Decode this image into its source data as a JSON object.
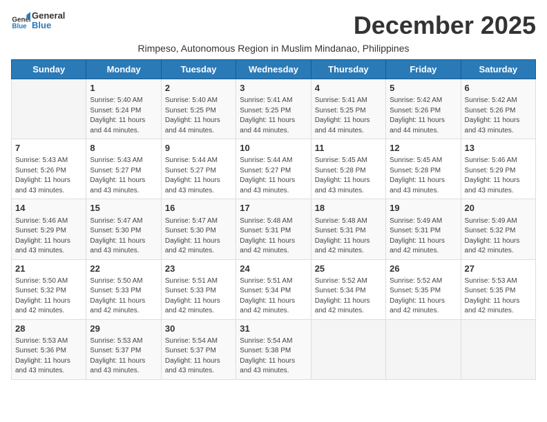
{
  "logo": {
    "general": "General",
    "blue": "Blue"
  },
  "title": "December 2025",
  "subtitle": "Rimpeso, Autonomous Region in Muslim Mindanao, Philippines",
  "days_of_week": [
    "Sunday",
    "Monday",
    "Tuesday",
    "Wednesday",
    "Thursday",
    "Friday",
    "Saturday"
  ],
  "weeks": [
    [
      {
        "day": "",
        "sunrise": "",
        "sunset": "",
        "daylight": ""
      },
      {
        "day": "1",
        "sunrise": "Sunrise: 5:40 AM",
        "sunset": "Sunset: 5:24 PM",
        "daylight": "Daylight: 11 hours and 44 minutes."
      },
      {
        "day": "2",
        "sunrise": "Sunrise: 5:40 AM",
        "sunset": "Sunset: 5:25 PM",
        "daylight": "Daylight: 11 hours and 44 minutes."
      },
      {
        "day": "3",
        "sunrise": "Sunrise: 5:41 AM",
        "sunset": "Sunset: 5:25 PM",
        "daylight": "Daylight: 11 hours and 44 minutes."
      },
      {
        "day": "4",
        "sunrise": "Sunrise: 5:41 AM",
        "sunset": "Sunset: 5:25 PM",
        "daylight": "Daylight: 11 hours and 44 minutes."
      },
      {
        "day": "5",
        "sunrise": "Sunrise: 5:42 AM",
        "sunset": "Sunset: 5:26 PM",
        "daylight": "Daylight: 11 hours and 44 minutes."
      },
      {
        "day": "6",
        "sunrise": "Sunrise: 5:42 AM",
        "sunset": "Sunset: 5:26 PM",
        "daylight": "Daylight: 11 hours and 43 minutes."
      }
    ],
    [
      {
        "day": "7",
        "sunrise": "Sunrise: 5:43 AM",
        "sunset": "Sunset: 5:26 PM",
        "daylight": "Daylight: 11 hours and 43 minutes."
      },
      {
        "day": "8",
        "sunrise": "Sunrise: 5:43 AM",
        "sunset": "Sunset: 5:27 PM",
        "daylight": "Daylight: 11 hours and 43 minutes."
      },
      {
        "day": "9",
        "sunrise": "Sunrise: 5:44 AM",
        "sunset": "Sunset: 5:27 PM",
        "daylight": "Daylight: 11 hours and 43 minutes."
      },
      {
        "day": "10",
        "sunrise": "Sunrise: 5:44 AM",
        "sunset": "Sunset: 5:27 PM",
        "daylight": "Daylight: 11 hours and 43 minutes."
      },
      {
        "day": "11",
        "sunrise": "Sunrise: 5:45 AM",
        "sunset": "Sunset: 5:28 PM",
        "daylight": "Daylight: 11 hours and 43 minutes."
      },
      {
        "day": "12",
        "sunrise": "Sunrise: 5:45 AM",
        "sunset": "Sunset: 5:28 PM",
        "daylight": "Daylight: 11 hours and 43 minutes."
      },
      {
        "day": "13",
        "sunrise": "Sunrise: 5:46 AM",
        "sunset": "Sunset: 5:29 PM",
        "daylight": "Daylight: 11 hours and 43 minutes."
      }
    ],
    [
      {
        "day": "14",
        "sunrise": "Sunrise: 5:46 AM",
        "sunset": "Sunset: 5:29 PM",
        "daylight": "Daylight: 11 hours and 43 minutes."
      },
      {
        "day": "15",
        "sunrise": "Sunrise: 5:47 AM",
        "sunset": "Sunset: 5:30 PM",
        "daylight": "Daylight: 11 hours and 43 minutes."
      },
      {
        "day": "16",
        "sunrise": "Sunrise: 5:47 AM",
        "sunset": "Sunset: 5:30 PM",
        "daylight": "Daylight: 11 hours and 42 minutes."
      },
      {
        "day": "17",
        "sunrise": "Sunrise: 5:48 AM",
        "sunset": "Sunset: 5:31 PM",
        "daylight": "Daylight: 11 hours and 42 minutes."
      },
      {
        "day": "18",
        "sunrise": "Sunrise: 5:48 AM",
        "sunset": "Sunset: 5:31 PM",
        "daylight": "Daylight: 11 hours and 42 minutes."
      },
      {
        "day": "19",
        "sunrise": "Sunrise: 5:49 AM",
        "sunset": "Sunset: 5:31 PM",
        "daylight": "Daylight: 11 hours and 42 minutes."
      },
      {
        "day": "20",
        "sunrise": "Sunrise: 5:49 AM",
        "sunset": "Sunset: 5:32 PM",
        "daylight": "Daylight: 11 hours and 42 minutes."
      }
    ],
    [
      {
        "day": "21",
        "sunrise": "Sunrise: 5:50 AM",
        "sunset": "Sunset: 5:32 PM",
        "daylight": "Daylight: 11 hours and 42 minutes."
      },
      {
        "day": "22",
        "sunrise": "Sunrise: 5:50 AM",
        "sunset": "Sunset: 5:33 PM",
        "daylight": "Daylight: 11 hours and 42 minutes."
      },
      {
        "day": "23",
        "sunrise": "Sunrise: 5:51 AM",
        "sunset": "Sunset: 5:33 PM",
        "daylight": "Daylight: 11 hours and 42 minutes."
      },
      {
        "day": "24",
        "sunrise": "Sunrise: 5:51 AM",
        "sunset": "Sunset: 5:34 PM",
        "daylight": "Daylight: 11 hours and 42 minutes."
      },
      {
        "day": "25",
        "sunrise": "Sunrise: 5:52 AM",
        "sunset": "Sunset: 5:34 PM",
        "daylight": "Daylight: 11 hours and 42 minutes."
      },
      {
        "day": "26",
        "sunrise": "Sunrise: 5:52 AM",
        "sunset": "Sunset: 5:35 PM",
        "daylight": "Daylight: 11 hours and 42 minutes."
      },
      {
        "day": "27",
        "sunrise": "Sunrise: 5:53 AM",
        "sunset": "Sunset: 5:35 PM",
        "daylight": "Daylight: 11 hours and 42 minutes."
      }
    ],
    [
      {
        "day": "28",
        "sunrise": "Sunrise: 5:53 AM",
        "sunset": "Sunset: 5:36 PM",
        "daylight": "Daylight: 11 hours and 43 minutes."
      },
      {
        "day": "29",
        "sunrise": "Sunrise: 5:53 AM",
        "sunset": "Sunset: 5:37 PM",
        "daylight": "Daylight: 11 hours and 43 minutes."
      },
      {
        "day": "30",
        "sunrise": "Sunrise: 5:54 AM",
        "sunset": "Sunset: 5:37 PM",
        "daylight": "Daylight: 11 hours and 43 minutes."
      },
      {
        "day": "31",
        "sunrise": "Sunrise: 5:54 AM",
        "sunset": "Sunset: 5:38 PM",
        "daylight": "Daylight: 11 hours and 43 minutes."
      },
      {
        "day": "",
        "sunrise": "",
        "sunset": "",
        "daylight": ""
      },
      {
        "day": "",
        "sunrise": "",
        "sunset": "",
        "daylight": ""
      },
      {
        "day": "",
        "sunrise": "",
        "sunset": "",
        "daylight": ""
      }
    ]
  ]
}
